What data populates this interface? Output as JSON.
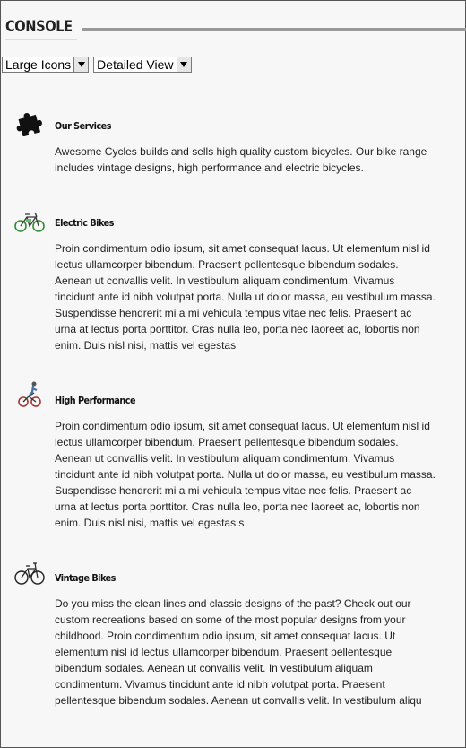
{
  "header": {
    "title": "CONSOLE"
  },
  "view_controls": {
    "icon_size": {
      "selected": "Large Icons"
    },
    "view_mode": {
      "selected": "Detailed View"
    }
  },
  "items": [
    {
      "icon": "puzzle-piece-icon",
      "title": "Our Services",
      "body": "Awesome Cycles builds and sells high quality custom bicycles. Our bike range includes vintage designs, high performance and electric bicycles."
    },
    {
      "icon": "electric-bike-icon",
      "title": "Electric Bikes",
      "body": "Proin condimentum odio ipsum, sit amet consequat lacus. Ut elementum nisl id lectus ullamcorper bibendum. Praesent pellentesque bibendum sodales. Aenean ut convallis velit. In vestibulum aliquam condimentum. Vivamus tincidunt ante id nibh volutpat porta. Nulla ut dolor massa, eu vestibulum massa. Suspendisse hendrerit mi a mi vehicula tempus vitae nec felis. Praesent ac urna at lectus porta porttitor. Cras nulla leo, porta nec laoreet ac, lobortis non enim. Duis nisl nisi, mattis vel egestas"
    },
    {
      "icon": "bmx-rider-icon",
      "title": "High Performance",
      "body": "Proin condimentum odio ipsum, sit amet consequat lacus. Ut elementum nisl id lectus ullamcorper bibendum. Praesent pellentesque bibendum sodales. Aenean ut convallis velit. In vestibulum aliquam condimentum. Vivamus tincidunt ante id nibh volutpat porta. Nulla ut dolor massa, eu vestibulum massa. Suspendisse hendrerit mi a mi vehicula tempus vitae nec felis. Praesent ac urna at lectus porta porttitor. Cras nulla leo, porta nec laoreet ac, lobortis non enim. Duis nisl nisi, mattis vel egestas s"
    },
    {
      "icon": "vintage-bike-icon",
      "title": "Vintage Bikes",
      "body": "Do you miss the clean lines and classic designs of the past? Check out our custom recreations based on some of the most popular designs from your childhood. Proin condimentum odio ipsum, sit amet consequat lacus. Ut elementum nisl id lectus ullamcorper bibendum. Praesent pellentesque bibendum sodales. Aenean ut convallis velit. In vestibulum aliquam condimentum. Vivamus tincidunt ante id nibh volutpat porta. Praesent pellentesque bibendum sodales. Aenean ut convallis velit. In vestibulum aliqu"
    }
  ]
}
